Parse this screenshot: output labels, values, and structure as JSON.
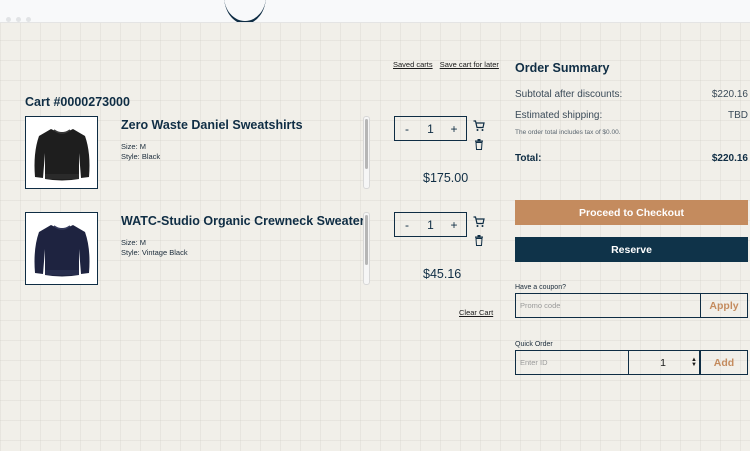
{
  "header": {},
  "cart_links": {
    "saved_carts": "Saved carts",
    "save_for_later": "Save cart for later"
  },
  "cart": {
    "title": "Cart #0000273000",
    "items": [
      {
        "name": "Zero Waste Daniel Sweatshirts",
        "size": "Size: M",
        "style": "Style: Black",
        "quantity": "1",
        "price": "$175.00",
        "minus": "-",
        "plus": "+"
      },
      {
        "name": "WATC-Studio Organic Crewneck Sweater",
        "size": "Size: M",
        "style": "Style: Vintage Black",
        "quantity": "1",
        "price": "$45.16",
        "minus": "-",
        "plus": "+"
      }
    ],
    "clear_cart": "Clear Cart"
  },
  "summary": {
    "title": "Order Summary",
    "subtotal_label": "Subtotal after discounts:",
    "subtotal_value": "$220.16",
    "shipping_label": "Estimated shipping:",
    "shipping_value": "TBD",
    "tax_note": "The order total includes tax of $0.00.",
    "total_label": "Total:",
    "total_value": "$220.16",
    "checkout_label": "Proceed to Checkout",
    "reserve_label": "Reserve",
    "coupon_label": "Have a coupon?",
    "coupon_placeholder": "Promo code",
    "apply_label": "Apply",
    "quick_order_label": "Quick Order",
    "quick_order_placeholder": "Enter ID",
    "quick_order_qty": "1",
    "add_label": "Add"
  },
  "colors": {
    "navy": "#0f2d44",
    "copper": "#c48b5e",
    "background": "#f1efe9"
  }
}
